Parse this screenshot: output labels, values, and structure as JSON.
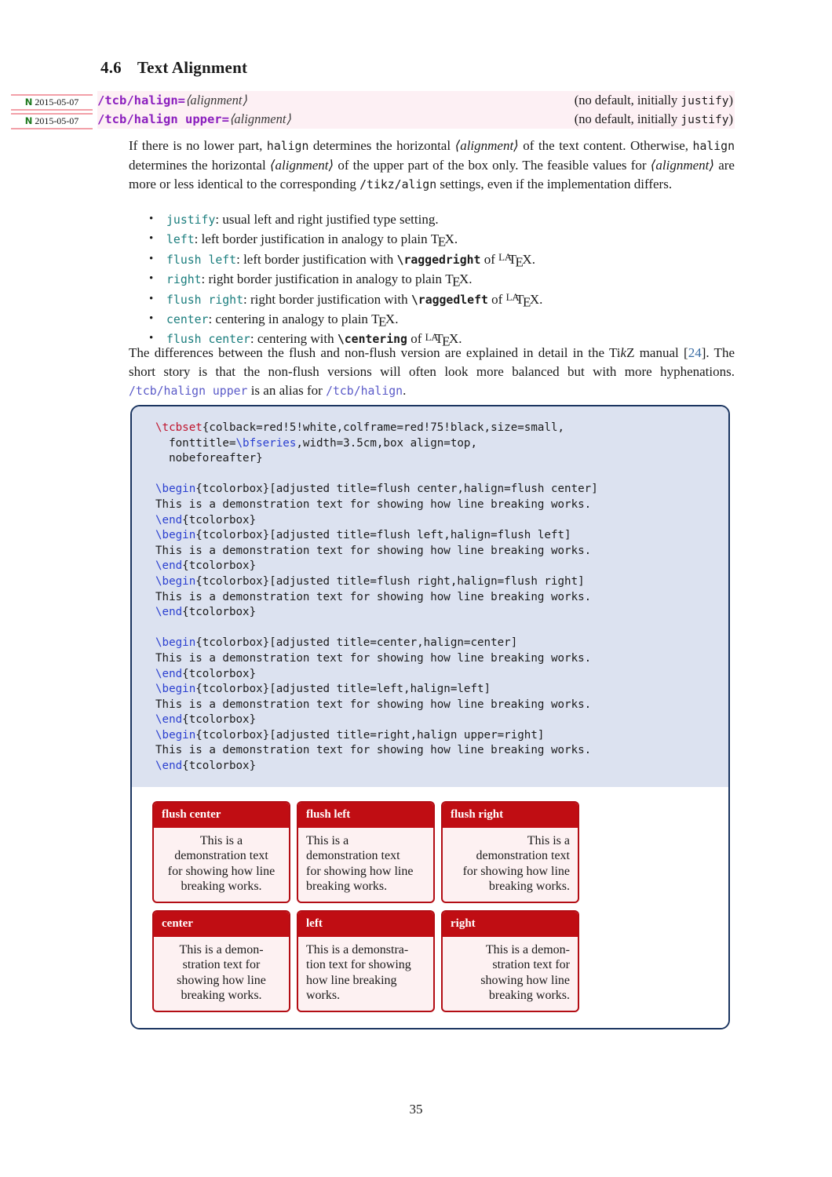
{
  "page": {
    "number": "35"
  },
  "section": {
    "number": "4.6",
    "title": "Text Alignment"
  },
  "keys": [
    {
      "margin_flag": "N",
      "margin_date": "2015-05-07",
      "name": "/tcb/halign",
      "equals": "=",
      "arg": "⟨alignment⟩",
      "default_prefix": "(no default, initially ",
      "default_value": "justify",
      "default_suffix": ")"
    },
    {
      "margin_flag": "N",
      "margin_date": "2015-05-07",
      "name": "/tcb/halign upper",
      "equals": "=",
      "arg": "⟨alignment⟩",
      "default_prefix": "(no default, initially ",
      "default_value": "justify",
      "default_suffix": ")"
    }
  ],
  "paragraph1": {
    "t1": "If there is no lower part, ",
    "m1": "halign",
    "t2": " determines the horizontal ",
    "a1": "⟨alignment⟩",
    "t3": " of the text content. Otherwise, ",
    "m2": "halign",
    "t4": " determines the horizontal ",
    "a2": "⟨alignment⟩",
    "t5": " of the upper part of the box only. The feasible values for ",
    "a3": "⟨alignment⟩",
    "t6": " are more or less identical to the corresponding ",
    "m3": "/tikz/align",
    "t7": " settings, even if the implementation differs."
  },
  "bullets": [
    {
      "kw": "justify",
      "rest": ": usual left and right justified type setting.",
      "cmd": "",
      "tail": "",
      "logo": ""
    },
    {
      "kw": "left",
      "rest": ": left border justification in analogy to plain ",
      "cmd": "",
      "tail": ".",
      "logo": "tex"
    },
    {
      "kw": "flush left",
      "rest": ": left border justification with ",
      "cmd": "\\raggedright",
      "tail": " of ",
      "logo": "latex",
      "end": "."
    },
    {
      "kw": "right",
      "rest": ": right border justification in analogy to plain ",
      "cmd": "",
      "tail": ".",
      "logo": "tex"
    },
    {
      "kw": "flush right",
      "rest": ": right border justification with ",
      "cmd": "\\raggedleft",
      "tail": " of ",
      "logo": "latex",
      "end": "."
    },
    {
      "kw": "center",
      "rest": ": centering in analogy to plain ",
      "cmd": "",
      "tail": ".",
      "logo": "tex"
    },
    {
      "kw": "flush center",
      "rest": ": centering with ",
      "cmd": "\\centering",
      "tail": " of ",
      "logo": "latex",
      "end": "."
    }
  ],
  "paragraph2": {
    "t1": "The differences between the flush and non-flush version are explained in detail in the Ti",
    "kitalic": "k",
    "t2": "Z manual [",
    "cite": "24",
    "t3": "]. The short story is that the non-flush versions will often look more balanced but with more hyphenations. ",
    "key1": "/tcb/halign upper",
    "t4": " is an alias for ",
    "key2": "/tcb/halign",
    "t5": "."
  },
  "example": {
    "code_lines": [
      {
        "segments": [
          {
            "type": "cmd-red",
            "text": "\\tcbset"
          },
          {
            "type": "plain",
            "text": "{colback=red!5!white,colframe=red!75!black,size=small,"
          }
        ]
      },
      {
        "segments": [
          {
            "type": "plain",
            "text": "  fonttitle="
          },
          {
            "type": "cmd-blue",
            "text": "\\bfseries"
          },
          {
            "type": "plain",
            "text": ",width=3.5cm,box align=top,"
          }
        ]
      },
      {
        "segments": [
          {
            "type": "plain",
            "text": "  nobeforeafter}"
          }
        ]
      },
      {
        "segments": [
          {
            "type": "plain",
            "text": ""
          }
        ]
      },
      {
        "segments": [
          {
            "type": "cmd-blue",
            "text": "\\begin"
          },
          {
            "type": "plain",
            "text": "{tcolorbox}[adjusted title=flush center,halign=flush center]"
          }
        ]
      },
      {
        "segments": [
          {
            "type": "plain",
            "text": "This is a demonstration text for showing how line breaking works."
          }
        ]
      },
      {
        "segments": [
          {
            "type": "cmd-blue",
            "text": "\\end"
          },
          {
            "type": "plain",
            "text": "{tcolorbox}"
          }
        ]
      },
      {
        "segments": [
          {
            "type": "cmd-blue",
            "text": "\\begin"
          },
          {
            "type": "plain",
            "text": "{tcolorbox}[adjusted title=flush left,halign=flush left]"
          }
        ]
      },
      {
        "segments": [
          {
            "type": "plain",
            "text": "This is a demonstration text for showing how line breaking works."
          }
        ]
      },
      {
        "segments": [
          {
            "type": "cmd-blue",
            "text": "\\end"
          },
          {
            "type": "plain",
            "text": "{tcolorbox}"
          }
        ]
      },
      {
        "segments": [
          {
            "type": "cmd-blue",
            "text": "\\begin"
          },
          {
            "type": "plain",
            "text": "{tcolorbox}[adjusted title=flush right,halign=flush right]"
          }
        ]
      },
      {
        "segments": [
          {
            "type": "plain",
            "text": "This is a demonstration text for showing how line breaking works."
          }
        ]
      },
      {
        "segments": [
          {
            "type": "cmd-blue",
            "text": "\\end"
          },
          {
            "type": "plain",
            "text": "{tcolorbox}"
          }
        ]
      },
      {
        "segments": [
          {
            "type": "plain",
            "text": ""
          }
        ]
      },
      {
        "segments": [
          {
            "type": "cmd-blue",
            "text": "\\begin"
          },
          {
            "type": "plain",
            "text": "{tcolorbox}[adjusted title=center,halign=center]"
          }
        ]
      },
      {
        "segments": [
          {
            "type": "plain",
            "text": "This is a demonstration text for showing how line breaking works."
          }
        ]
      },
      {
        "segments": [
          {
            "type": "cmd-blue",
            "text": "\\end"
          },
          {
            "type": "plain",
            "text": "{tcolorbox}"
          }
        ]
      },
      {
        "segments": [
          {
            "type": "cmd-blue",
            "text": "\\begin"
          },
          {
            "type": "plain",
            "text": "{tcolorbox}[adjusted title=left,halign=left]"
          }
        ]
      },
      {
        "segments": [
          {
            "type": "plain",
            "text": "This is a demonstration text for showing how line breaking works."
          }
        ]
      },
      {
        "segments": [
          {
            "type": "cmd-blue",
            "text": "\\end"
          },
          {
            "type": "plain",
            "text": "{tcolorbox}"
          }
        ]
      },
      {
        "segments": [
          {
            "type": "cmd-blue",
            "text": "\\begin"
          },
          {
            "type": "plain",
            "text": "{tcolorbox}[adjusted title=right,halign upper=right]"
          }
        ]
      },
      {
        "segments": [
          {
            "type": "plain",
            "text": "This is a demonstration text for showing how line breaking works."
          }
        ]
      },
      {
        "segments": [
          {
            "type": "cmd-blue",
            "text": "\\end"
          },
          {
            "type": "plain",
            "text": "{tcolorbox}"
          }
        ]
      }
    ],
    "result_rows": [
      [
        {
          "title": "flush center",
          "align": "al-center",
          "lines": [
            "This is a",
            "demonstration text",
            "for showing how line",
            "breaking works."
          ]
        },
        {
          "title": "flush left",
          "align": "al-left",
          "lines": [
            "This is a",
            "demonstration text",
            "for showing how line",
            "breaking works."
          ]
        },
        {
          "title": "flush right",
          "align": "al-right",
          "lines": [
            "This is a",
            "demonstration text",
            "for showing how line",
            "breaking works."
          ]
        }
      ],
      [
        {
          "title": "center",
          "align": "al-center",
          "lines": [
            "This is a demon-",
            "stration text for",
            "showing how line",
            "breaking works."
          ]
        },
        {
          "title": "left",
          "align": "al-left",
          "lines": [
            "This is a demonstra-",
            "tion text for showing",
            "how line breaking",
            "works."
          ]
        },
        {
          "title": "right",
          "align": "al-right",
          "lines": [
            "This is a demon-",
            "stration text for",
            "showing how line",
            "breaking works."
          ]
        }
      ]
    ]
  },
  "colors": {
    "key_purple": "#8b1fbe",
    "list_teal": "#1a7d7d",
    "code_red": "#c0142d",
    "code_blue": "#2a3fd0",
    "frame_navy": "#1b3560",
    "code_bg": "#dce2f0",
    "tcb_red": "#c00d13",
    "tcb_bg": "#fdf1f2",
    "keyband_bg": "#fdf0f4",
    "margin_green": "#1f7a1f",
    "margin_rule": "#f2a0a8",
    "cite_blue": "#3b6ea5"
  }
}
